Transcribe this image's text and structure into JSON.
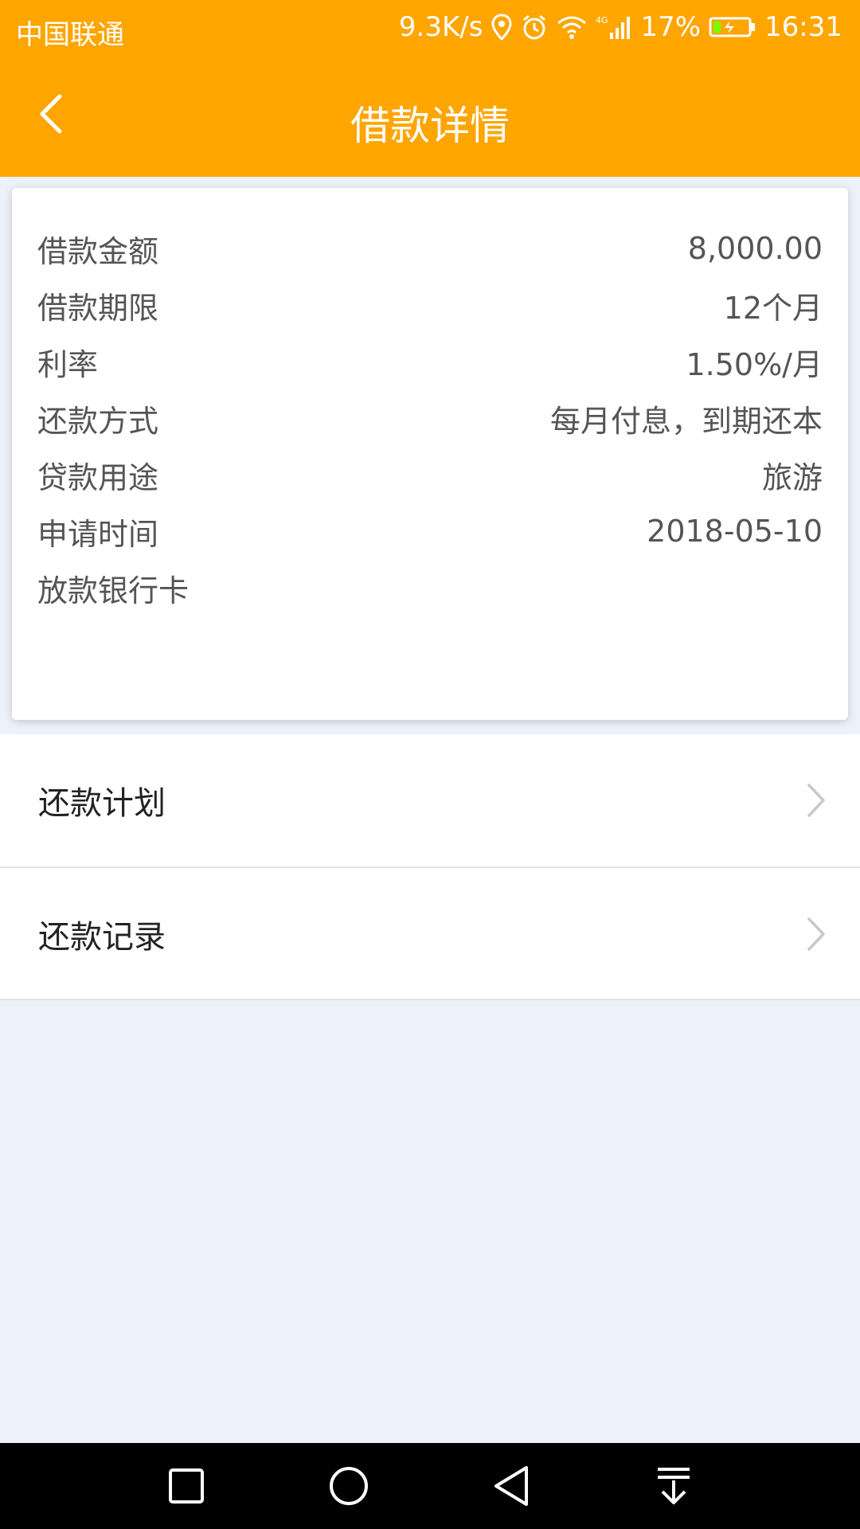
{
  "status_bar": {
    "carrier": "中国联通",
    "net_speed": "9.3K/s",
    "network_type": "4G",
    "battery": "17%",
    "time": "16:31"
  },
  "header": {
    "title": "借款详情",
    "back_icon": "chevron-left-icon"
  },
  "details": [
    {
      "label": "借款金额",
      "value": "8,000.00"
    },
    {
      "label": "借款期限",
      "value": "12个月"
    },
    {
      "label": "利率",
      "value": "1.50%/月"
    },
    {
      "label": "还款方式",
      "value": "每月付息，到期还本"
    },
    {
      "label": "贷款用途",
      "value": "旅游"
    },
    {
      "label": "申请时间",
      "value": "2018-05-10"
    },
    {
      "label": "放款银行卡",
      "value": ""
    }
  ],
  "menu": [
    {
      "label": "还款计划",
      "icon": "chevron-right-icon"
    },
    {
      "label": "还款记录",
      "icon": "chevron-right-icon"
    }
  ],
  "colors": {
    "accent": "#FFA500",
    "background": "#ECF1FA",
    "card": "#FFFFFF",
    "text_secondary": "#555555",
    "text_primary": "#222222"
  }
}
